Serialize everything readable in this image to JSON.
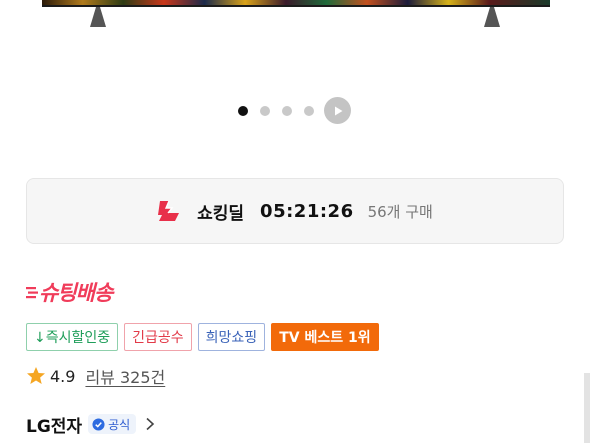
{
  "product_image": {
    "carousel_index": 1,
    "carousel_total": 4
  },
  "deal": {
    "icon": "lightning-logo-icon",
    "label": "쇼킹딜",
    "timer": "05:21:26",
    "purchase_count": "56개 구매"
  },
  "shipping_logo": "슈팅배송",
  "tags": [
    {
      "label": "↓즉시할인중",
      "color": "#1f9e5a"
    },
    {
      "label": "긴급공수",
      "color": "#e23a48"
    },
    {
      "label": "희망쇼핑",
      "color": "#3b63b8"
    },
    {
      "label": "TV 베스트 1위",
      "color": "#f26a0a"
    }
  ],
  "rating": {
    "score": "4.9",
    "reviews": "리뷰 325건",
    "star_color": "#f5a623"
  },
  "seller": {
    "name": "LG전자",
    "badge": "공식"
  }
}
